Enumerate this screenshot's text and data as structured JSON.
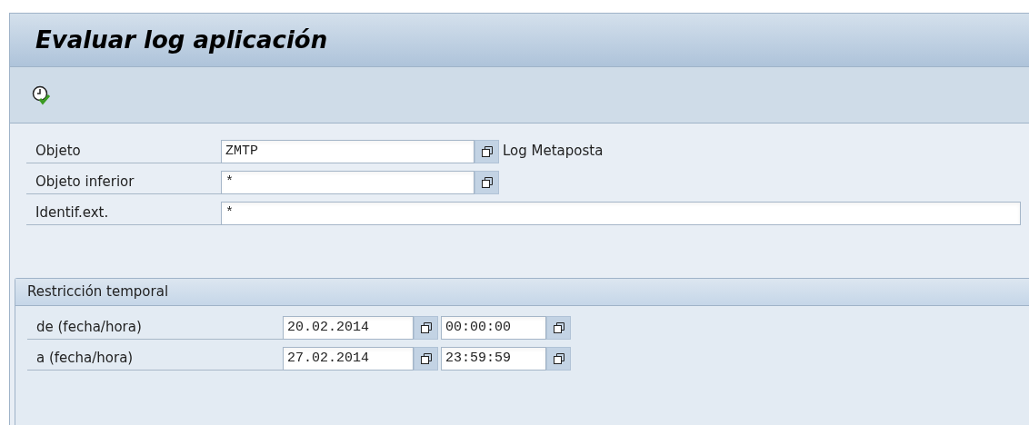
{
  "window": {
    "title": "Evaluar log aplicación"
  },
  "fields": [
    {
      "label": "Objeto",
      "value": "ZMTP",
      "kind": "help",
      "description": "Log Metaposta"
    },
    {
      "label": "Objeto inferior",
      "value": "*",
      "kind": "help"
    },
    {
      "label": "Identif.ext.",
      "value": "*",
      "kind": "wide"
    }
  ],
  "group": {
    "title": "Restricción temporal",
    "rows": [
      {
        "label": "de (fecha/hora)",
        "date": "20.02.2014",
        "time": "00:00:00"
      },
      {
        "label": "a (fecha/hora)",
        "date": "27.02.2014",
        "time": "23:59:59"
      }
    ]
  }
}
